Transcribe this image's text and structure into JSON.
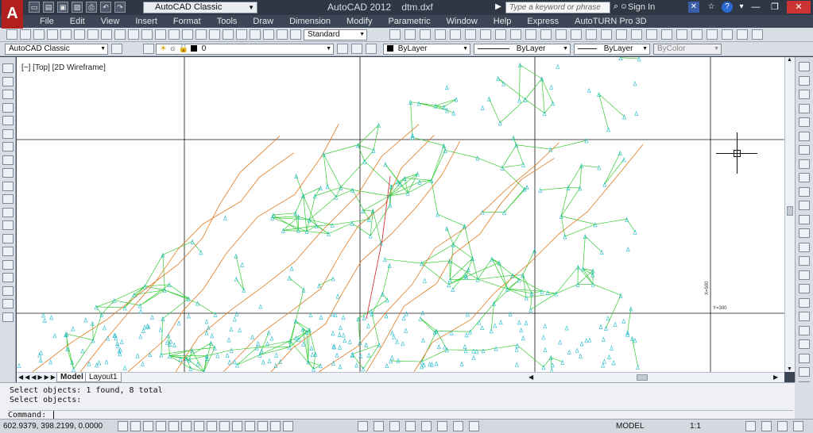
{
  "titlebar": {
    "logo": "A",
    "workspace": "AutoCAD Classic",
    "app_name": "AutoCAD 2012",
    "file_name": "dtm.dxf",
    "search_placeholder": "Type a keyword or phrase",
    "sign_in": "Sign In"
  },
  "menu": [
    "File",
    "Edit",
    "View",
    "Insert",
    "Format",
    "Tools",
    "Draw",
    "Dimension",
    "Modify",
    "Parametric",
    "Window",
    "Help",
    "Express",
    "AutoTURN Pro 3D"
  ],
  "toolbar": {
    "text_style": "Standard",
    "workspace": "AutoCAD Classic",
    "layer": "0",
    "color": "ByLayer",
    "linetype": "ByLayer",
    "lineweight": "ByLayer",
    "plotstyle": "ByColor"
  },
  "viewport": {
    "label": "[−] [Top] [2D Wireframe]",
    "x_label": "X=500",
    "y_label": "Y=300"
  },
  "tabs": [
    "Model",
    "Layout1"
  ],
  "command": {
    "line1": "Select objects: 1 found, 8 total",
    "line2": "Select objects:",
    "prompt": "Command:"
  },
  "status": {
    "coords": "602.9379, 398.2199, 0.0000",
    "space": "MODEL",
    "scale": "1:1"
  },
  "colors": {
    "tin_lines": "#33cc33",
    "contours": "#e07a20",
    "points": "#22bbcc",
    "breakline": "#cc2222"
  }
}
